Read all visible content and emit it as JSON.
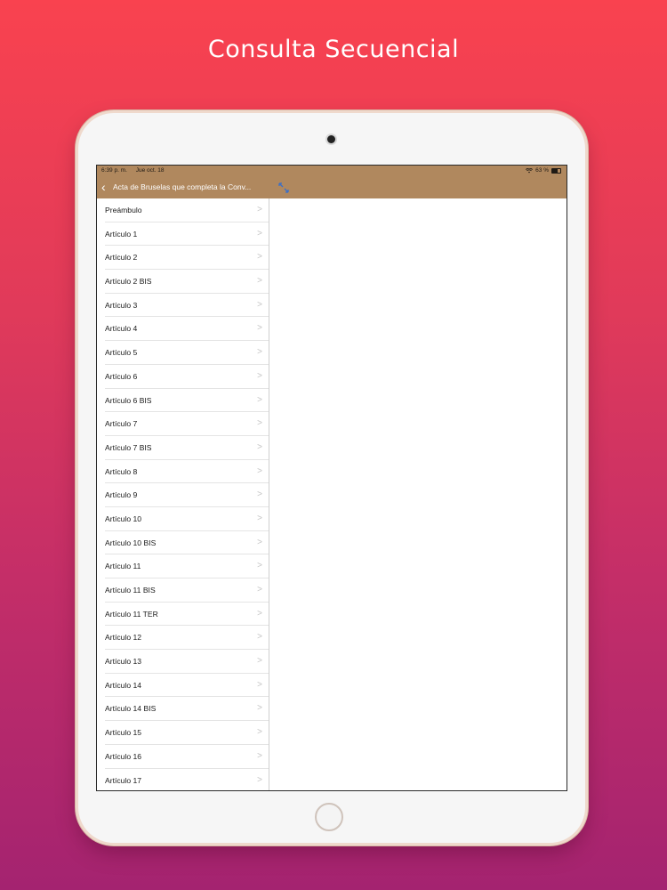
{
  "headline": "Consulta Secuencial",
  "status_bar": {
    "time": "6:39 p. m.",
    "date": "Jue oct. 18",
    "battery": "63 %",
    "icons": [
      "wifi-icon",
      "battery-icon"
    ]
  },
  "nav": {
    "title": "Acta de Bruselas que completa la Conv...",
    "back_icon": "chevron-left-icon",
    "expand_icon": "expand-icon"
  },
  "colors": {
    "accent": "#b0885e",
    "background_top": "#f9424f",
    "background_bottom": "#a42370"
  },
  "list": {
    "items": [
      {
        "label": "Preámbulo"
      },
      {
        "label": "Artículo 1"
      },
      {
        "label": "Artículo 2"
      },
      {
        "label": "Artículo 2 BIS"
      },
      {
        "label": "Artículo 3"
      },
      {
        "label": "Artículo 4"
      },
      {
        "label": "Artículo 5"
      },
      {
        "label": "Artículo 6"
      },
      {
        "label": "Artículo 6 BIS"
      },
      {
        "label": "Artículo 7"
      },
      {
        "label": "Artículo 7 BIS"
      },
      {
        "label": "Artículo 8"
      },
      {
        "label": "Artículo 9"
      },
      {
        "label": "Artículo 10"
      },
      {
        "label": "Artículo 10 BIS"
      },
      {
        "label": "Artículo 11"
      },
      {
        "label": "Artículo 11 BIS"
      },
      {
        "label": "Artículo 11 TER"
      },
      {
        "label": "Artículo 12"
      },
      {
        "label": "Artículo 13"
      },
      {
        "label": "Artículo 14"
      },
      {
        "label": "Artículo 14 BIS"
      },
      {
        "label": "Artículo 15"
      },
      {
        "label": "Artículo 16"
      },
      {
        "label": "Artículo 17"
      }
    ]
  }
}
